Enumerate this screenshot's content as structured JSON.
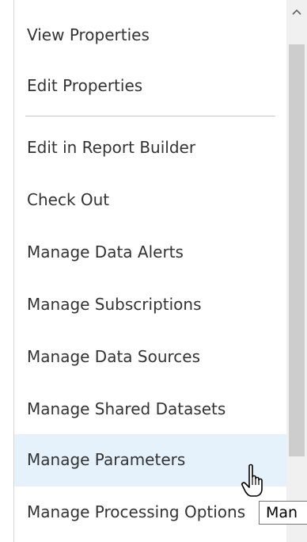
{
  "menu": {
    "items": [
      {
        "label": "View Properties"
      },
      {
        "label": "Edit Properties"
      },
      {
        "label": "Edit in Report Builder"
      },
      {
        "label": "Check Out"
      },
      {
        "label": "Manage Data Alerts"
      },
      {
        "label": "Manage Subscriptions"
      },
      {
        "label": "Manage Data Sources"
      },
      {
        "label": "Manage Shared Datasets"
      },
      {
        "label": "Manage Parameters",
        "state": "hovered"
      },
      {
        "label": "Manage Processing Options"
      }
    ]
  },
  "tooltip": {
    "text": "Man"
  },
  "icons": {
    "scroll_up": "chevron-up-icon",
    "cursor": "hand-pointer-icon"
  },
  "colors": {
    "hover_background": "#e5f1fb",
    "text": "#333333",
    "scrollbar_track": "#f0f0f0",
    "scrollbar_thumb": "#cdcdcd"
  }
}
